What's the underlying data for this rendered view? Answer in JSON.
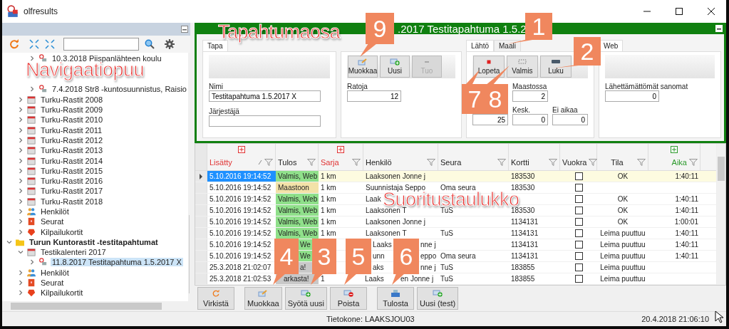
{
  "window": {
    "title": "olfresults"
  },
  "navigation": {
    "tree": [
      {
        "children": [
          {
            "children": [
              {
                "kind": "event",
                "label": "10.3.2018  Piispanlähteen koulu",
                "expanded": false
              },
              {
                "kind": "event",
                "label": "7.4.2018  Str8 -kuntosuunnistus, Raisio",
                "expanded": false
              }
            ]
          },
          {
            "kind": "calendar",
            "label": "Turku-Rastit 2008",
            "expanded": false
          },
          {
            "kind": "calendar",
            "label": "Turku-Rastit 2009",
            "expanded": false
          },
          {
            "kind": "calendar",
            "label": "Turku-Rastit 2010",
            "expanded": false
          },
          {
            "kind": "calendar",
            "label": "Turku-Rastit 2011",
            "expanded": false
          },
          {
            "kind": "calendar",
            "label": "Turku-Rastit 2012",
            "expanded": false
          },
          {
            "kind": "calendar",
            "label": "Turku-Rastit 2013",
            "expanded": false
          },
          {
            "kind": "calendar",
            "label": "Turku-Rastit 2014",
            "expanded": false
          },
          {
            "kind": "calendar",
            "label": "Turku-Rastit 2015",
            "expanded": false
          },
          {
            "kind": "calendar",
            "label": "Turku-Rastit 2016",
            "expanded": false
          },
          {
            "kind": "calendar",
            "label": "Turku-Rastit 2017",
            "expanded": false
          },
          {
            "kind": "calendar",
            "label": "Turku-Rastit 2018",
            "expanded": false
          },
          {
            "kind": "persons",
            "label": "Henkilöt",
            "expanded": false
          },
          {
            "kind": "clubs",
            "label": "Seurat",
            "expanded": false
          },
          {
            "kind": "cards",
            "label": "Kilpailukortit",
            "expanded": false
          }
        ]
      },
      {
        "kind": "folder",
        "label": "Turun Kuntorastit -testitapahtumat",
        "expanded": true,
        "children": [
          {
            "kind": "calendar",
            "label": "Testikalenteri 2017",
            "expanded": true,
            "children": [
              {
                "kind": "event",
                "label": "11.8.2017  Testitapahtuma 1.5.2017 X",
                "expanded": false,
                "selected": true
              }
            ]
          },
          {
            "kind": "persons",
            "label": "Henkilöt",
            "expanded": false
          },
          {
            "kind": "clubs",
            "label": "Seurat",
            "expanded": false
          },
          {
            "kind": "cards",
            "label": "Kilpailukortit",
            "expanded": false
          }
        ]
      }
    ]
  },
  "event_panel": {
    "title": ".2017 Testitapahtuma 1.5.2",
    "event": {
      "tab": "Tapa",
      "name_label": "Nimi",
      "name_value": "Testitapahtuma 1.5.2017 X",
      "organizer_label": "Järjestäjä"
    },
    "courses": {
      "buttons": [
        {
          "label": "Muokkaa",
          "kind": "edit",
          "disabled": false
        },
        {
          "label": "Uusi",
          "kind": "add",
          "disabled": false
        },
        {
          "label": "Tuo",
          "kind": "import",
          "disabled": true
        }
      ],
      "field_label": "Ratoja",
      "field_value": "12"
    },
    "start": {
      "tabs": [
        {
          "label": "Lähtö",
          "selected": true
        },
        {
          "label": "Maali",
          "selected": false
        }
      ],
      "buttons": [
        {
          "label": "Lopeta",
          "kind": "stop"
        },
        {
          "label": "Valmis",
          "kind": "flag"
        },
        {
          "label": "Luku",
          "kind": "reader"
        }
      ],
      "fields": [
        {
          "label": "Maastossa",
          "value": "2"
        },
        {
          "value": "25"
        },
        {
          "label": "Kesk.",
          "value": "0"
        },
        {
          "label": "Ei aikaa",
          "value": "0"
        }
      ]
    },
    "web": {
      "tab": "Web",
      "field_label": "Lähettämättömät sanomat",
      "field_value": "0"
    }
  },
  "results_table": {
    "columns": [
      {
        "label": "Lisätty",
        "color": "#e03131",
        "group_icon": true,
        "sorted": true
      },
      {
        "label": "Tulos"
      },
      {
        "label": "Sarja",
        "color": "#e03131",
        "group_icon": true
      },
      {
        "label": "Henkilö"
      },
      {
        "label": "Seura"
      },
      {
        "label": "Kortti"
      },
      {
        "label": "Vuokra"
      },
      {
        "label": "Tila"
      },
      {
        "label": "Aika",
        "color": "#2b9a2b",
        "group_icon": true
      }
    ],
    "rows": [
      {
        "selected": true,
        "added": "5.10.2016 19:14:52",
        "result": "Valmis, Web",
        "color": "#8fe08a",
        "class": "1 km",
        "person": [
          "Laaksonen Jonne j"
        ],
        "card": "183530",
        "rented": false,
        "status": "OK",
        "time": "1:40:11"
      },
      {
        "selected": false,
        "added": "5.10.2016 19:14:52",
        "result": "Maastoon",
        "color": "#f3e2a8",
        "class": "1 km",
        "person": [
          "Suunnistaja Seppo"
        ],
        "club": "Oma seura",
        "card": "183530",
        "rented": false
      },
      {
        "selected": false,
        "added": "5.10.2016 19:14:52",
        "result": "Valmis, Web",
        "color": "#8fe08a",
        "class": "1 km",
        "person": [
          "Laak"
        ],
        "rented": false,
        "status": "OK",
        "time": "1:40:11"
      },
      {
        "selected": false,
        "added": "5.10.2016 19:14:52",
        "result": "Valmis, Web",
        "color": "#8fe08a",
        "class": "1 km",
        "person": [
          "Laaksonen T"
        ],
        "club": "TuS",
        "card": "183530",
        "rented": false,
        "status": "OK",
        "time": "1:40:11"
      },
      {
        "selected": false,
        "added": "5.10.2016 19:14:52",
        "result": "Valmis, Web",
        "color": "#8fe08a",
        "class": "1 km",
        "person": [
          "Laaksonen Jonne j"
        ],
        "card": "1134131",
        "rented": false,
        "status": "OK",
        "time": "1:00:01"
      },
      {
        "selected": false,
        "added": "5.10.2016 19:14:52",
        "result": "Valmis, Web",
        "color": "#8fe08a",
        "class": "1 km",
        "person": [
          "Laaksonen T"
        ],
        "club": "TuS",
        "card": "1134131",
        "rented": false,
        "status": "Leima puuttuu",
        "time": "1:40:11"
      },
      {
        "selected": false,
        "added": "5.10.2016 19:14:52",
        "result": "We",
        "color": "#8fe08a",
        "person": [
          "Laaks",
          "nne j"
        ],
        "card": "1134131",
        "rented": false,
        "status": "Leima puuttuu",
        "time": "1:40:11"
      },
      {
        "selected": false,
        "added": "5.10.2016 19:14:52",
        "result": "We",
        "color": "#8fe08a",
        "person": [
          "unn",
          "eppo"
        ],
        "club": "Oma seura",
        "card": "1134131",
        "rented": false,
        "status": "Leima puuttuu",
        "time": "1:40:11"
      },
      {
        "selected": false,
        "added": "25.3.2018 21:02:07",
        "result": "a!",
        "color": "#c8c8c8",
        "person": [
          "aks",
          "nne j"
        ],
        "club": "TuS",
        "card": "183855",
        "rented": false,
        "status": "Leima puuttuu"
      },
      {
        "selected": false,
        "added": "25.3.2018 21:02:53",
        "result": "arkasta!",
        "color": "#c8c8c8",
        "class": "1",
        "person": [
          "Laaks",
          "en Jonne j"
        ],
        "club": "TuS",
        "card": "183855",
        "rented": false,
        "status": "Leima puuttuu"
      }
    ]
  },
  "bottom_buttons": [
    {
      "label": "Virkistä",
      "kind": "refresh"
    },
    {
      "label": "Muokkaa",
      "kind": "edit"
    },
    {
      "label": "Syötä uusi",
      "kind": "add"
    },
    {
      "label": "Poista",
      "kind": "delete"
    },
    {
      "label": "Tulosta",
      "kind": "print"
    },
    {
      "label": "Uusi (test)",
      "kind": "add"
    }
  ],
  "status_bar": {
    "computer": "Tietokone: LAAKSJOU03",
    "datetime": "20.4.2018 21:06:10"
  },
  "annotations": {
    "labels": [
      "Navigaatiopuu",
      "Tapahtumaosa",
      "Suoritustaulukko"
    ],
    "callouts": [
      "9",
      "1",
      "2",
      "7",
      "8",
      "4",
      "3",
      "5",
      "6"
    ]
  }
}
